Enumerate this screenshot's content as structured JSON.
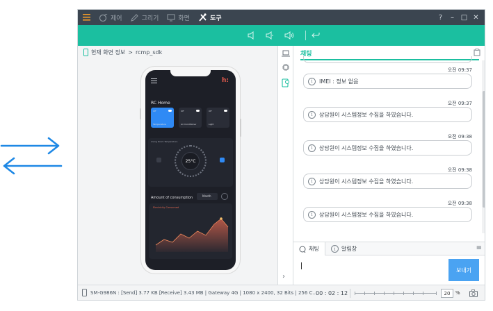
{
  "menu": {
    "items": [
      {
        "label": "제어",
        "icon": "control-icon",
        "active": false
      },
      {
        "label": "그리기",
        "icon": "pencil-icon",
        "active": false
      },
      {
        "label": "화면",
        "icon": "monitor-icon",
        "active": false
      },
      {
        "label": "도구",
        "icon": "tools-icon",
        "active": true
      }
    ],
    "help": "?",
    "minimize": "–",
    "maximize": "□",
    "close": "✕"
  },
  "left_pane": {
    "breadcrumb": [
      "현재 화면 정보",
      "rcmp_sdk"
    ],
    "breadcrumb_sep": ">"
  },
  "phone_app": {
    "title": "RC Home",
    "cards": [
      {
        "top": "Off",
        "label": "Temperature",
        "on": true
      },
      {
        "top": "Off",
        "label": "Air Conditioner",
        "on": false
      },
      {
        "top": "Off",
        "label": "Light",
        "on": false
      }
    ],
    "thermostat_label": "Living Room Temperature",
    "temperature": "25°C",
    "consumption_title": "Amount of consumption",
    "consumption_period": "Month",
    "chart_legend": "Electricity Consumed"
  },
  "chat": {
    "title": "채팅",
    "messages": [
      {
        "time": "오전 09:37",
        "text": "IMEI : 정보 없음"
      },
      {
        "time": "오전 09:37",
        "text": "상담원이 시스템정보 수집을 하였습니다."
      },
      {
        "time": "오전 09:38",
        "text": "상담원이 시스템정보 수집을 하였습니다."
      },
      {
        "time": "오전 09:38",
        "text": "상담원이 시스템정보 수집을 하였습니다."
      },
      {
        "time": "오전 09:38",
        "text": "상담원이 시스템정보 수집을 하였습니다."
      }
    ],
    "tabs": [
      {
        "label": "채팅",
        "icon": "chat-icon"
      },
      {
        "label": "알림창",
        "icon": "alert-icon"
      }
    ],
    "send_label": "보내기"
  },
  "status": {
    "device_info": "SM-G986N : [Send] 3.77 KB  [Receive] 3.43 MB | Gateway 4G | 1080 x 2400, 32 Bits | 256 C...",
    "elapsed": "00 : 02 : 12",
    "zoom": "20",
    "zoom_unit": "%"
  },
  "colors": {
    "menubar": "#3b4550",
    "toolbar": "#1bbfa0",
    "accent": "#1bbfa0",
    "send": "#4aa3f2",
    "arrows": "#1e88e5"
  }
}
